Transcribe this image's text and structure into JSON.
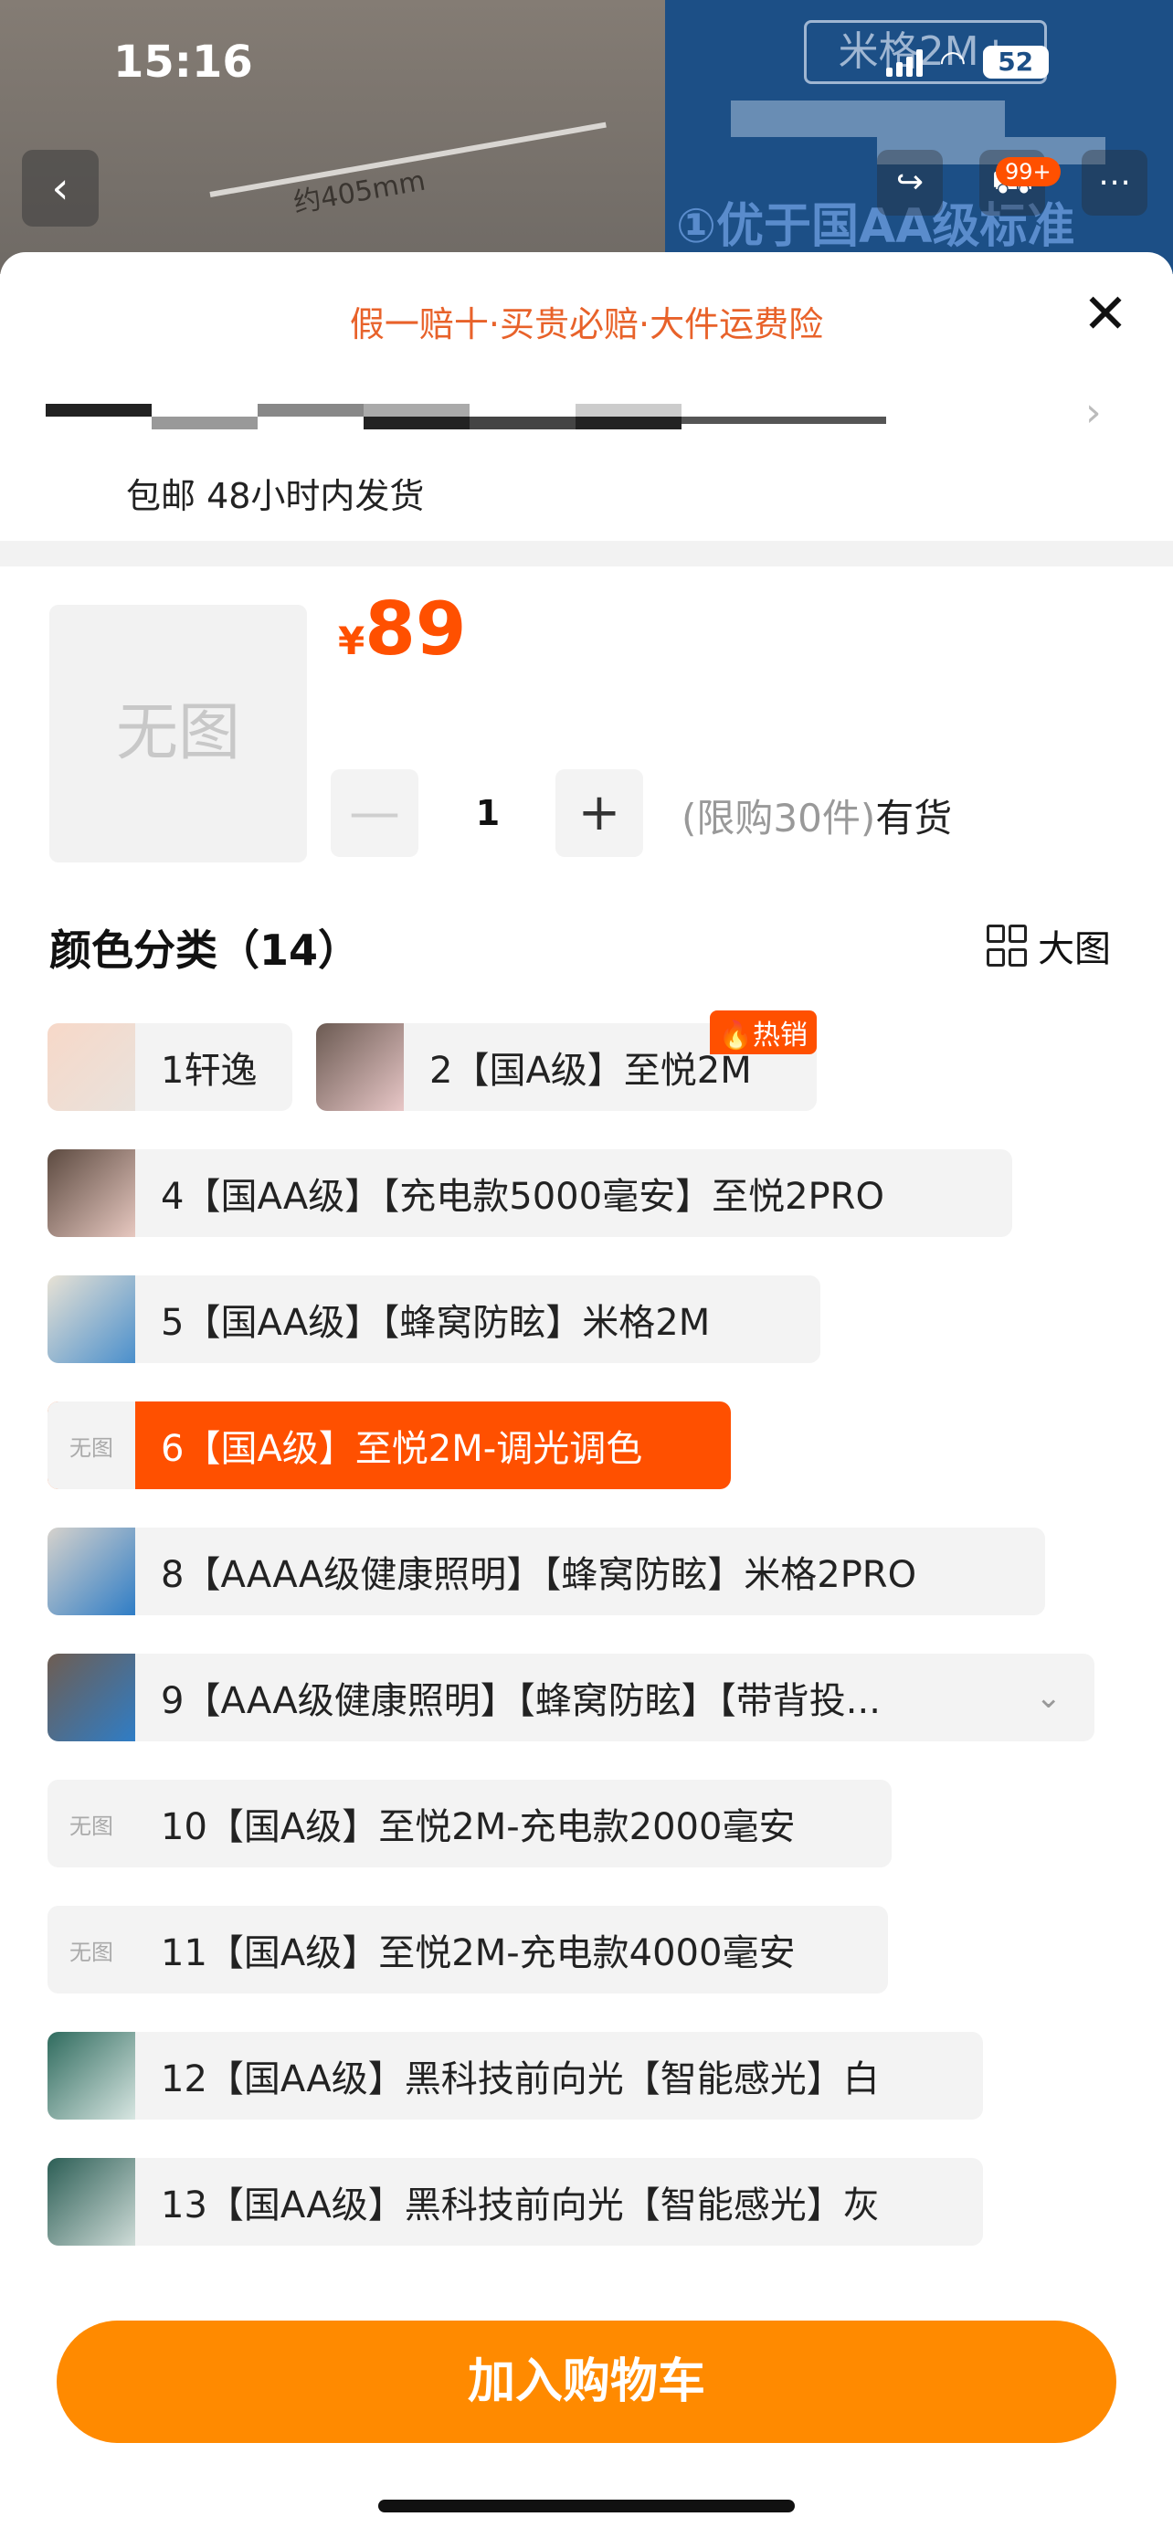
{
  "status": {
    "time": "15:16",
    "battery": "52"
  },
  "background": {
    "dimension": "约405mm",
    "right_title": "米格2M+",
    "right_text": "①优于国AA级标准",
    "cart_badge": "99+"
  },
  "sheet": {
    "guarantee": "假一赔十·买贵必赔·大件运费险",
    "shipping": "包邮 48小时内发货",
    "product_image_placeholder": "无图",
    "price": {
      "currency": "¥",
      "amount": "89"
    },
    "quantity": {
      "value": "1",
      "minus": "—",
      "plus": "+"
    },
    "stock": {
      "limit": "(限购30件)",
      "availability": "有货"
    },
    "section": {
      "title": "颜色分类（14）",
      "big_view": "大图"
    },
    "options": [
      {
        "label": "1轩逸",
        "hot": ""
      },
      {
        "label": "2【国A级】至悦2M",
        "hot": "🔥热销"
      },
      {
        "label": "4【国AA级】【充电款5000毫安】至悦2PRO"
      },
      {
        "label": "5【国AA级】【蜂窝防眩】米格2M"
      },
      {
        "label": "6【国A级】至悦2M-调光调色",
        "thumb_text": "无图"
      },
      {
        "label": "8【AAAA级健康照明】【蜂窝防眩】米格2PRO"
      },
      {
        "label": "9【AAA级健康照明】【蜂窝防眩】【带背投..."
      },
      {
        "label": "10【国A级】至悦2M-充电款2000毫安",
        "thumb_text": "无图"
      },
      {
        "label": "11【国A级】至悦2M-充电款4000毫安",
        "thumb_text": "无图"
      },
      {
        "label": "12【国AA级】黑科技前向光【智能感光】白"
      },
      {
        "label": "13【国AA级】黑科技前向光【智能感光】灰"
      }
    ],
    "add_to_cart": "加入购物车"
  },
  "colors": {
    "accent": "#ff5000",
    "cart_button": "#ff8a00",
    "guarantee_text": "#e8622a"
  }
}
